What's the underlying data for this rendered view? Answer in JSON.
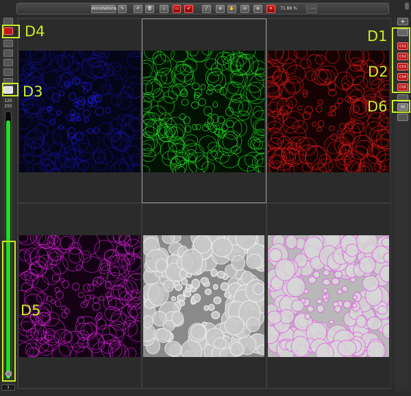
{
  "toolbar": {
    "annotations_label": "Annotations",
    "zoom_level": "71.88 %",
    "live_label": "Live"
  },
  "left_panel": {
    "display_max": "120",
    "display_range": "255",
    "slider_level_fraction": 0.97,
    "slider_min": "1"
  },
  "right_panel": {
    "channels": [
      "Ch1",
      "Ch2",
      "Ch3",
      "Ch4",
      "Ch5"
    ],
    "three_d_label": "3D"
  },
  "viewer": {
    "panels": [
      {
        "name": "blue-channel",
        "color": "#1a1ad8",
        "bg": "#05051a"
      },
      {
        "name": "green-channel",
        "color": "#22dd22",
        "bg": "#021202"
      },
      {
        "name": "red-channel",
        "color": "#dd1a1a",
        "bg": "#160202"
      },
      {
        "name": "magenta-channel",
        "color": "#d020d0",
        "bg": "#140214"
      },
      {
        "name": "brightfield",
        "color": "#f0f0f0",
        "bg": "#8a8a8a"
      },
      {
        "name": "merged-overlay",
        "color": "#e070e0",
        "bg": "#b8b8b8"
      }
    ]
  },
  "annotations": {
    "d1": "D1",
    "d2": "D2",
    "d3": "D3",
    "d4": "D4",
    "d5": "D5",
    "d6": "D6",
    "highlight_color": "#ccee22"
  }
}
